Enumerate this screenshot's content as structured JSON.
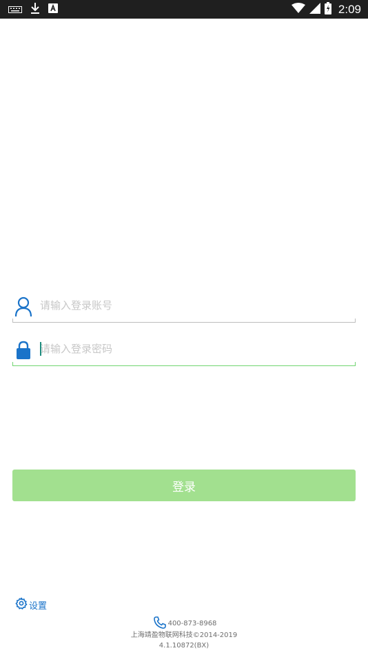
{
  "status_bar": {
    "time": "2:09",
    "left_icons": [
      "keyboard-icon",
      "download-icon",
      "app-notification-icon"
    ],
    "right_icons": [
      "wifi-icon",
      "cell-signal-icon",
      "battery-icon"
    ]
  },
  "login": {
    "account_placeholder": "请输入登录账号",
    "password_placeholder": "请输入登录密码",
    "login_label": "登录"
  },
  "settings": {
    "label": "设置"
  },
  "footer": {
    "phone": "400-873-8968",
    "company": "上海靖盈物联网科技©2014-2019",
    "version": "4.1.10872(BX)"
  },
  "colors": {
    "accent_blue": "#1a73c9",
    "login_button": "#a2e08f",
    "focus_underline": "#6fd46f",
    "status_bar": "#1f1f1f"
  }
}
